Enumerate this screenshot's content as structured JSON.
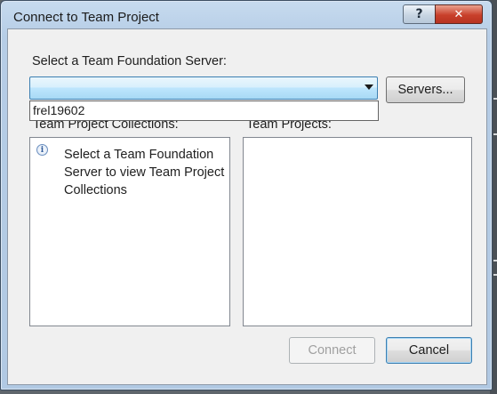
{
  "window": {
    "title": "Connect to Team Project",
    "help_glyph": "?",
    "close_glyph": "✕"
  },
  "server": {
    "label": "Select a Team Foundation Server:",
    "selected_value": "",
    "options": [
      "frel19602"
    ],
    "servers_button": "Servers..."
  },
  "collections": {
    "label": "Team Project Collections:",
    "message": "Select a Team Foundation Server to view Team Project Collections"
  },
  "projects": {
    "label": "Team Projects:",
    "items": []
  },
  "actions": {
    "connect": "Connect",
    "cancel": "Cancel"
  }
}
